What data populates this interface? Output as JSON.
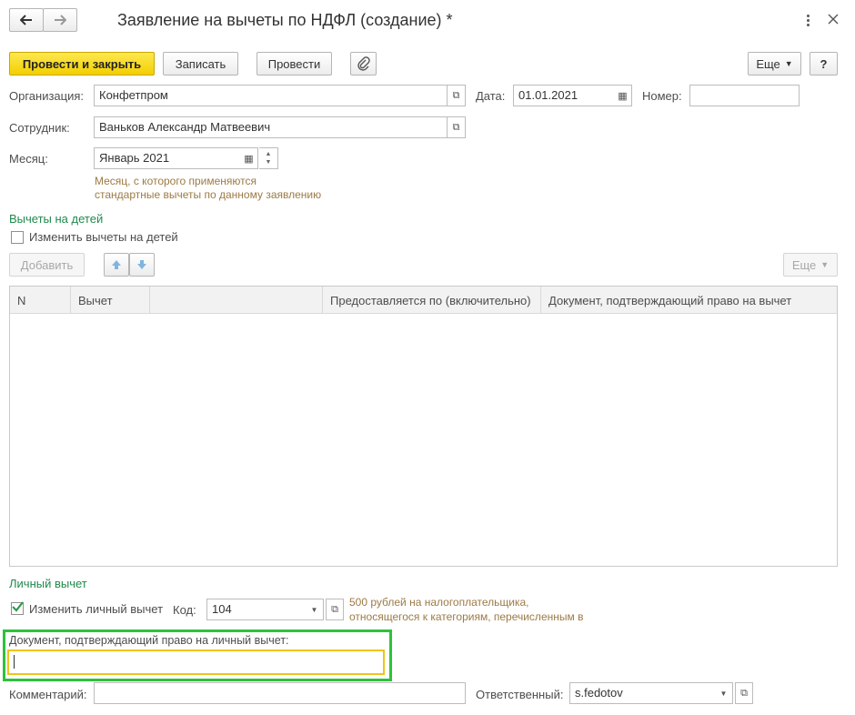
{
  "header": {
    "title": "Заявление на вычеты по НДФЛ (создание) *",
    "back_icon": "arrow-left",
    "forward_icon": "arrow-right",
    "menu_icon": "more-vertical",
    "close_icon": "close"
  },
  "toolbar": {
    "post_close_label": "Провести и закрыть",
    "save_label": "Записать",
    "post_label": "Провести",
    "more_label": "Еще",
    "help_label": "?"
  },
  "form": {
    "org_label": "Организация:",
    "org_value": "Конфетпром",
    "date_label": "Дата:",
    "date_value": "01.01.2021",
    "number_label": "Номер:",
    "number_value": "",
    "employee_label": "Сотрудник:",
    "employee_value": "Ваньков Александр Матвеевич",
    "month_label": "Месяц:",
    "month_value": "Январь 2021",
    "month_hint_1": "Месяц, с которого применяются",
    "month_hint_2": "стандартные вычеты по данному заявлению"
  },
  "children": {
    "section_title": "Вычеты на детей",
    "change_label": "Изменить вычеты на детей",
    "change_checked": false,
    "add_label": "Добавить",
    "more_label": "Еще",
    "columns": [
      "N",
      "Вычет",
      "",
      "Предоставляется по (включительно)",
      "Документ, подтверждающий право на вычет"
    ],
    "rows": []
  },
  "personal": {
    "section_title": "Личный вычет",
    "change_label": "Изменить личный вычет",
    "change_checked": true,
    "code_label": "Код:",
    "code_value": "104",
    "code_hint_1": "500 рублей на налогоплательщика,",
    "code_hint_2": "относящегося к категориям, перечисленным в",
    "doc_label": "Документ, подтверждающий право на личный вычет:",
    "doc_value": ""
  },
  "footer": {
    "comment_label": "Комментарий:",
    "comment_value": "",
    "responsible_label": "Ответственный:",
    "responsible_value": "s.fedotov"
  },
  "colors": {
    "accent_yellow": "#f3cf00",
    "section_green": "#1f8a4c",
    "highlight_green": "#2ec23a",
    "focus_yellow": "#f0c419",
    "hint_brown": "#9c7b45"
  }
}
